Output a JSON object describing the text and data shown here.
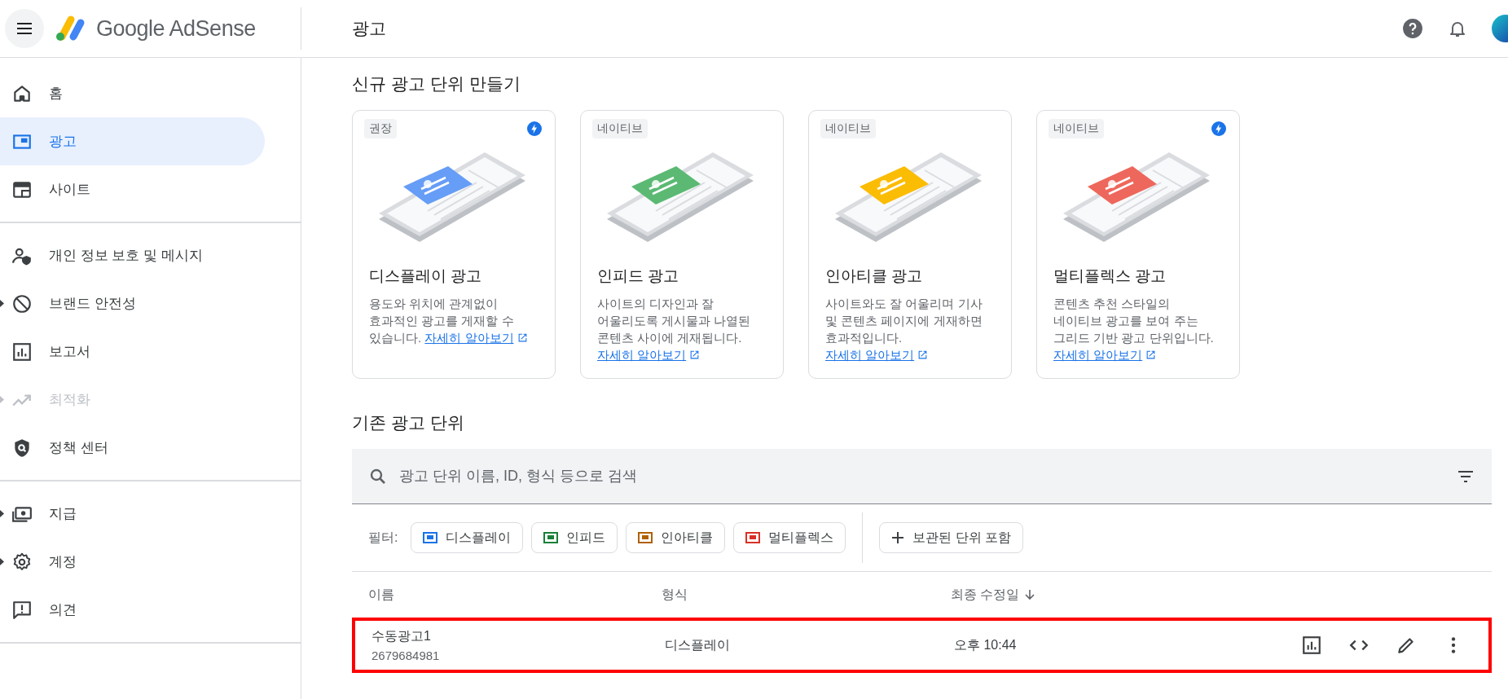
{
  "header": {
    "logo_text": "Google AdSense",
    "page_title": "광고"
  },
  "sidebar": {
    "groups": [
      {
        "items": [
          {
            "label": "홈",
            "selected": false,
            "disabled": false,
            "expandable": false
          },
          {
            "label": "광고",
            "selected": true,
            "disabled": false,
            "expandable": false
          },
          {
            "label": "사이트",
            "selected": false,
            "disabled": false,
            "expandable": false
          }
        ]
      },
      {
        "items": [
          {
            "label": "개인 정보 보호 및 메시지",
            "selected": false,
            "disabled": false,
            "expandable": false
          },
          {
            "label": "브랜드 안전성",
            "selected": false,
            "disabled": false,
            "expandable": true
          },
          {
            "label": "보고서",
            "selected": false,
            "disabled": false,
            "expandable": false
          },
          {
            "label": "최적화",
            "selected": false,
            "disabled": true,
            "expandable": true
          },
          {
            "label": "정책 센터",
            "selected": false,
            "disabled": false,
            "expandable": false
          }
        ]
      },
      {
        "items": [
          {
            "label": "지급",
            "selected": false,
            "disabled": false,
            "expandable": true
          },
          {
            "label": "계정",
            "selected": false,
            "disabled": false,
            "expandable": true
          },
          {
            "label": "의견",
            "selected": false,
            "disabled": false,
            "expandable": false
          }
        ]
      }
    ]
  },
  "create_section": {
    "title": "신규 광고 단위 만들기",
    "cards": [
      {
        "badge": "권장",
        "recommended": true,
        "color": "#669df6",
        "title": "디스플레이 광고",
        "description": "용도와 위치에 관계없이 효과적인 광고를 게재할 수 있습니다.",
        "link": "자세히 알아보기"
      },
      {
        "badge": "네이티브",
        "recommended": false,
        "color": "#5bb974",
        "title": "인피드 광고",
        "description": "사이트의 디자인과 잘 어울리도록 게시물과 나열된 콘텐츠 사이에 게재됩니다.",
        "link": "자세히 알아보기"
      },
      {
        "badge": "네이티브",
        "recommended": false,
        "color": "#fbbc04",
        "title": "인아티클 광고",
        "description": "사이트와도 잘 어울리며 기사 및 콘텐츠 페이지에 게재하면 효과적입니다.",
        "link": "자세히 알아보기"
      },
      {
        "badge": "네이티브",
        "recommended": true,
        "color": "#ee675c",
        "title": "멀티플렉스 광고",
        "description": "콘텐츠 추천 스타일의 네이티브 광고를 보여 주는 그리드 기반 광고 단위입니다.",
        "link": "자세히 알아보기"
      }
    ]
  },
  "existing_section": {
    "title": "기존 광고 단위",
    "search": {
      "placeholder": "광고 단위 이름, ID, 형식 등으로 검색"
    },
    "filter_label": "필터:",
    "filters": [
      {
        "label": "디스플레이",
        "color": "#1a73e8"
      },
      {
        "label": "인피드",
        "color": "#188038"
      },
      {
        "label": "인아티클",
        "color": "#b06000"
      },
      {
        "label": "멀티플렉스",
        "color": "#d93025"
      }
    ],
    "archive_chip": "보관된 단위 포함",
    "table": {
      "columns": [
        "이름",
        "형식",
        "최종 수정일"
      ],
      "rows": [
        {
          "name": "수동광고1",
          "id": "2679684981",
          "format": "디스플레이",
          "modified": "오후 10:44",
          "highlighted": true
        }
      ]
    }
  }
}
